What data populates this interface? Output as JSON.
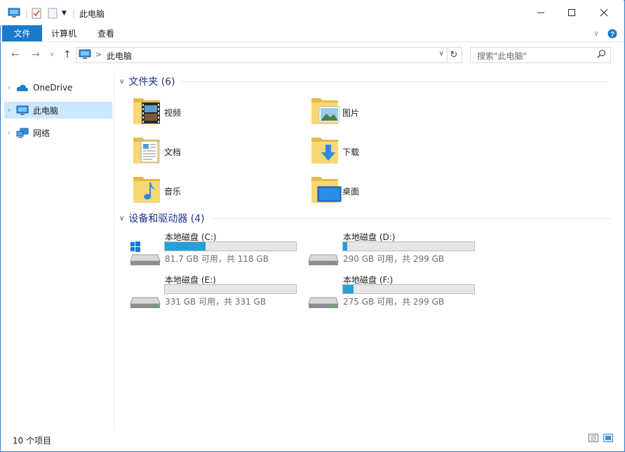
{
  "window": {
    "title": "此电脑"
  },
  "ribbon": {
    "tabs": [
      "文件",
      "计算机",
      "查看"
    ]
  },
  "address": {
    "location": "此电脑",
    "separator": ">"
  },
  "search": {
    "placeholder": "搜索\"此电脑\""
  },
  "nav_pane": {
    "items": [
      {
        "label": "OneDrive",
        "icon": "onedrive-icon"
      },
      {
        "label": "此电脑",
        "icon": "this-pc-icon",
        "selected": true
      },
      {
        "label": "网络",
        "icon": "network-icon"
      }
    ]
  },
  "folders_section": {
    "title": "文件夹 (6)"
  },
  "folders": [
    {
      "label": "视频",
      "overlay": "video"
    },
    {
      "label": "图片",
      "overlay": "picture"
    },
    {
      "label": "文档",
      "overlay": "document"
    },
    {
      "label": "下载",
      "overlay": "download"
    },
    {
      "label": "音乐",
      "overlay": "music"
    },
    {
      "label": "桌面",
      "overlay": "desktop"
    }
  ],
  "drives_section": {
    "title": "设备和驱动器 (4)"
  },
  "drives": [
    {
      "name": "本地磁盘 (C:)",
      "free_text": "81.7 GB 可用，共 118 GB",
      "used_fraction": 0.31,
      "system": true
    },
    {
      "name": "本地磁盘 (D:)",
      "free_text": "290 GB 可用，共 299 GB",
      "used_fraction": 0.03,
      "system": false
    },
    {
      "name": "本地磁盘 (E:)",
      "free_text": "331 GB 可用，共 331 GB",
      "used_fraction": 0.0,
      "system": false
    },
    {
      "name": "本地磁盘 (F:)",
      "free_text": "275 GB 可用，共 299 GB",
      "used_fraction": 0.08,
      "system": false
    }
  ],
  "status_bar": {
    "item_count": "10 个项目"
  },
  "colors": {
    "accent": "#1979ca",
    "selection": "#cce8ff",
    "bar_fill": "#26a0da",
    "section_title": "#1e3287"
  }
}
